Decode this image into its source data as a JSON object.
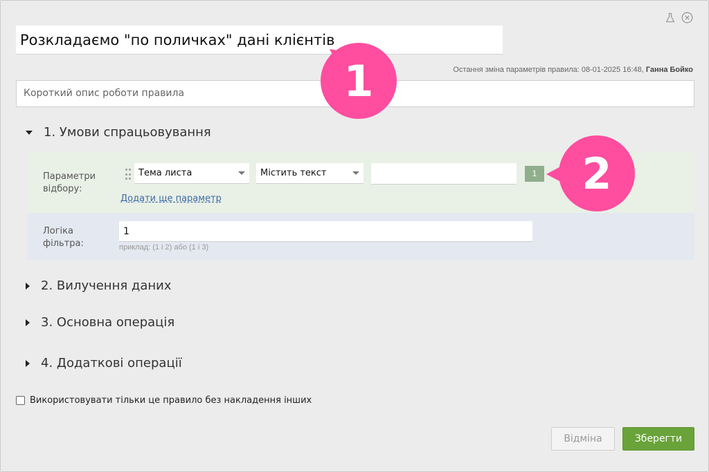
{
  "rule": {
    "title": "Розкладаємо \"по поличках\" дані клієнтів",
    "last_change_prefix": "Остання зміна параметрів правила: 08-01-2025 16:48, ",
    "last_change_user": "Ганна Бойко",
    "description_placeholder": "Короткий опис роботи правила"
  },
  "sections": [
    {
      "label": "1. Умови спрацьовування",
      "expanded": true
    },
    {
      "label": "2. Вилучення даних",
      "expanded": false
    },
    {
      "label": "3. Основна операція",
      "expanded": false
    },
    {
      "label": "4. Додаткові операції",
      "expanded": false
    }
  ],
  "conditions": {
    "params_label_line1": "Параметри",
    "params_label_line2": "відбору:",
    "field_select": "Тема листа",
    "operator_select": "Містить текст",
    "value": "",
    "param_number": "1",
    "add_param_link": "Додати ще параметр",
    "logic_label_line1": "Логіка",
    "logic_label_line2": "фільтра:",
    "logic_value": "1",
    "logic_hint": "приклад: (1 і 2) або (1 і 3)"
  },
  "callouts": [
    "1",
    "2"
  ],
  "checkbox": {
    "label": "Використовувати тільки це правило без накладення інших",
    "checked": false
  },
  "buttons": {
    "cancel": "Відміна",
    "save": "Зберегти"
  },
  "colors": {
    "accent_green": "#69a33a",
    "callout_pink": "#ff4d9f",
    "params_bg": "#e9f0e6",
    "logic_bg": "#e4e8f0",
    "link_blue": "#3b6aa8"
  },
  "icons": {
    "top_right": [
      "flask-icon",
      "close-circle-icon"
    ]
  }
}
